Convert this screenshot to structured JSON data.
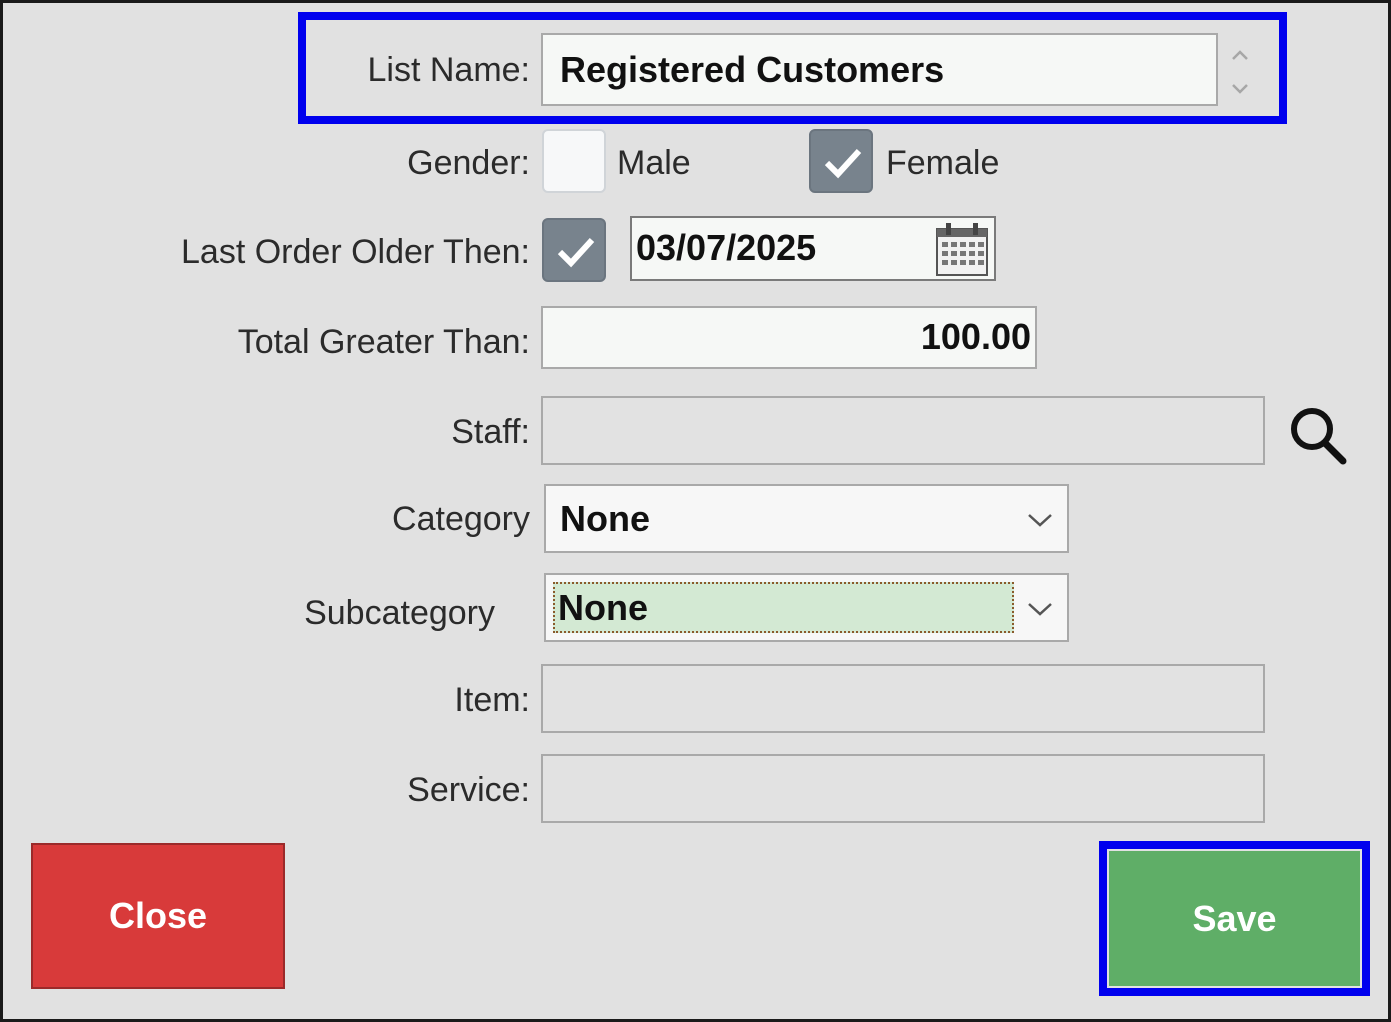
{
  "form": {
    "list_name": {
      "label": "List Name:",
      "value": "Registered Customers"
    },
    "gender": {
      "label": "Gender:",
      "male_label": "Male",
      "male_checked": false,
      "female_label": "Female",
      "female_checked": true
    },
    "last_order": {
      "label": "Last Order Older Then:",
      "checked": true,
      "date": "03/07/2025"
    },
    "total": {
      "label": "Total Greater Than:",
      "value": "100.00"
    },
    "staff": {
      "label": "Staff:",
      "value": ""
    },
    "category": {
      "label": "Category",
      "value": "None"
    },
    "subcategory": {
      "label": "Subcategory",
      "value": "None"
    },
    "item": {
      "label": "Item:",
      "value": ""
    },
    "service": {
      "label": "Service:",
      "value": ""
    }
  },
  "buttons": {
    "close_label": "Close",
    "save_label": "Save"
  },
  "icons": {
    "calendar": "calendar-icon",
    "search": "search-icon",
    "dropdown": "chevron-down-icon",
    "spinner": "spinner-arrows-icon",
    "check": "check-icon"
  },
  "colors": {
    "close": "#d83a3a",
    "save": "#5fae67",
    "highlight": "#0000ee",
    "subcategory_bg": "#d3e9d3",
    "checkbox_on": "#78838d"
  }
}
